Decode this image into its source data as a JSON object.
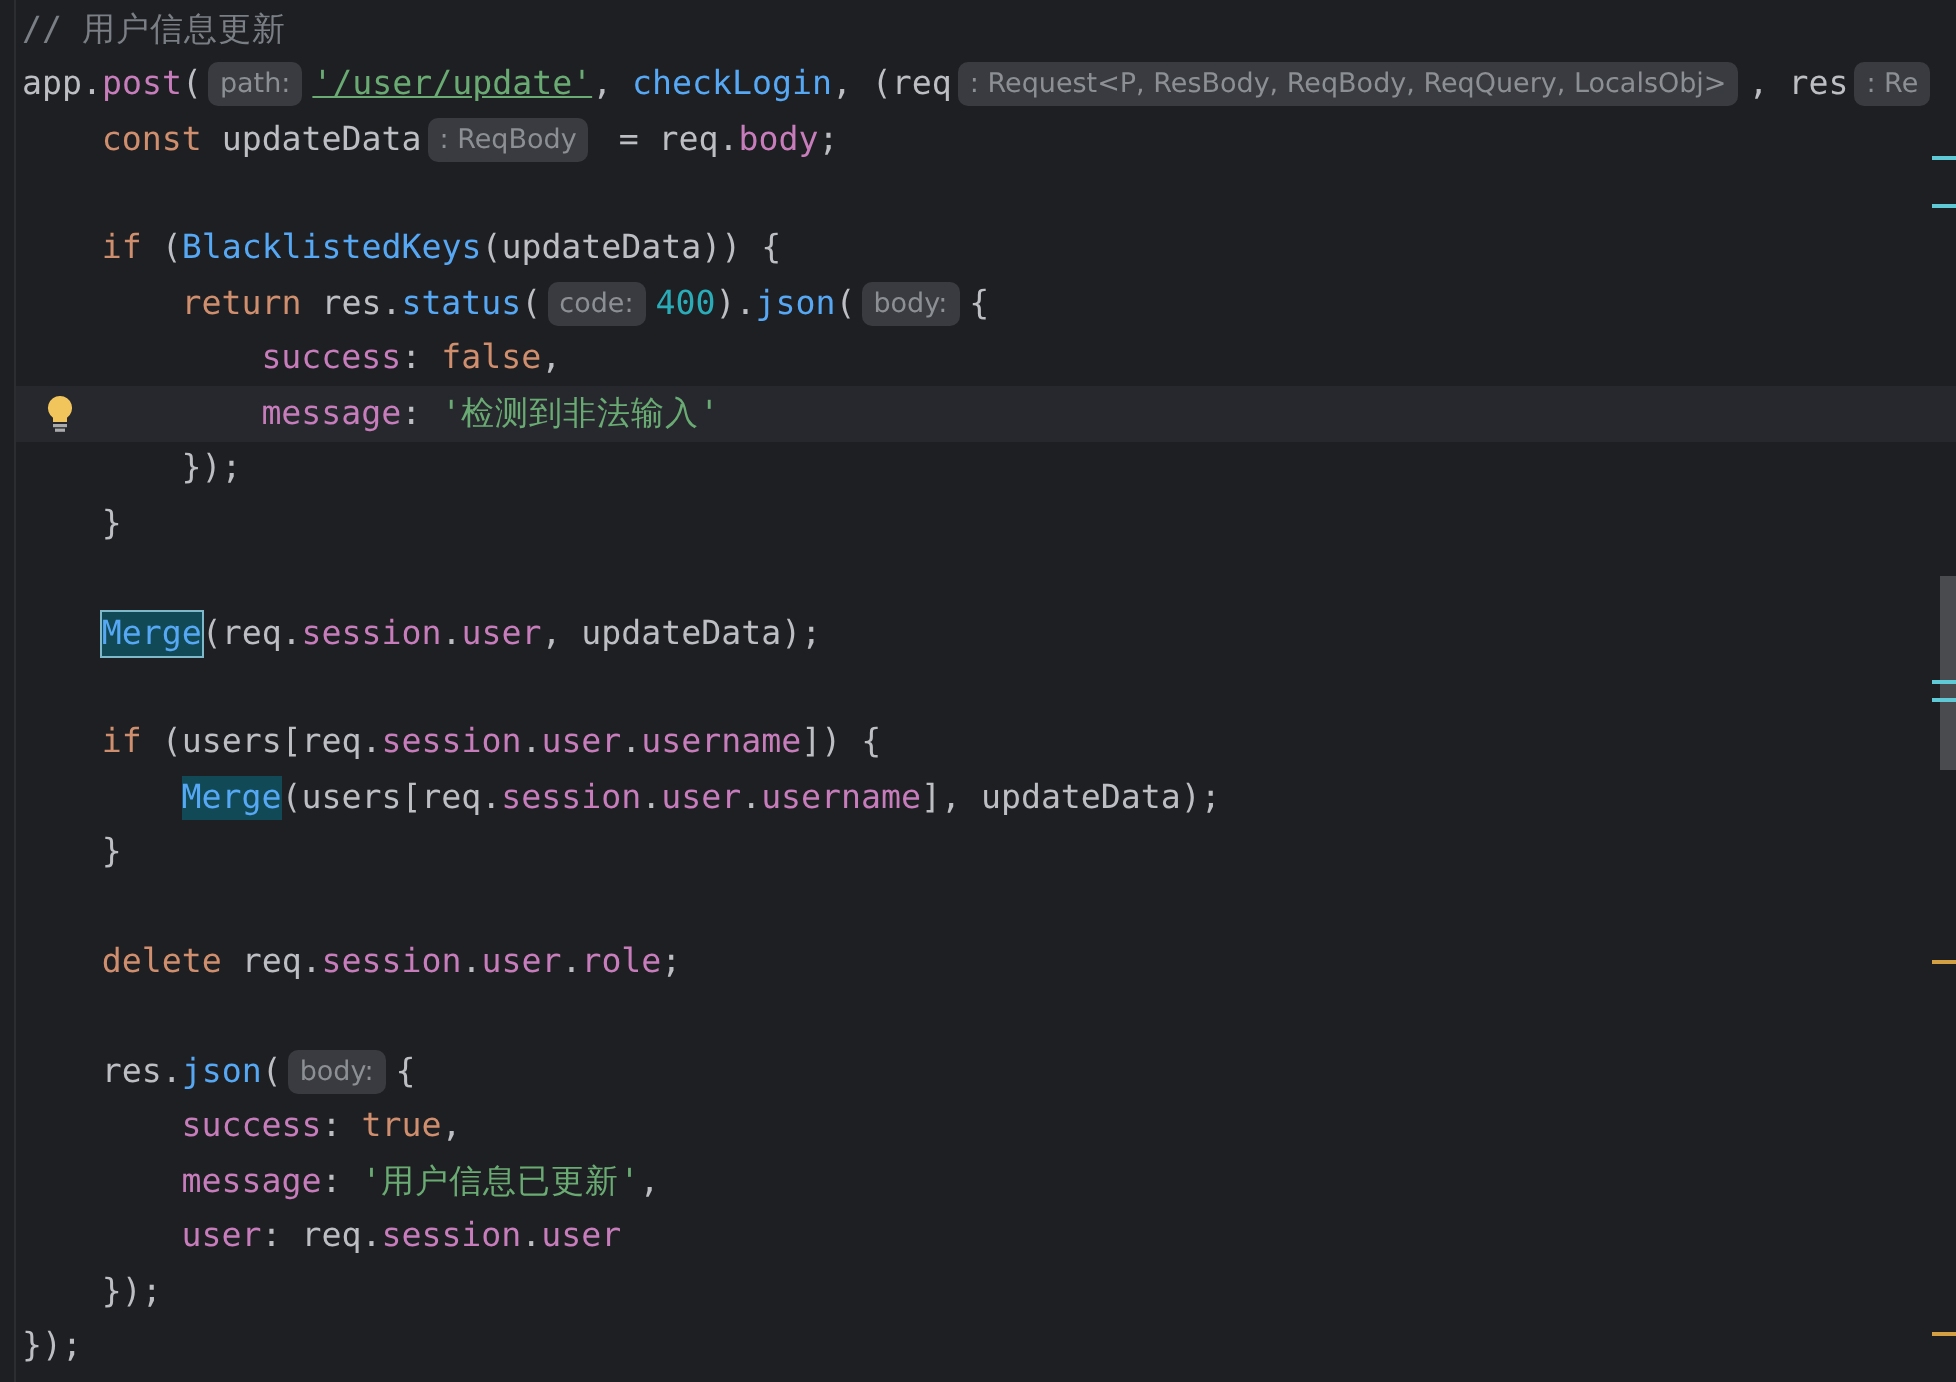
{
  "editor": {
    "lines": [
      {
        "current": false,
        "tokens": [
          {
            "kind": "comment",
            "t": "// 用户信息更新"
          }
        ]
      },
      {
        "current": false,
        "tokens": [
          {
            "kind": "plain",
            "t": "app."
          },
          {
            "kind": "prop",
            "t": "post"
          },
          {
            "kind": "plain",
            "t": "("
          },
          {
            "kind": "hint",
            "t": "path:"
          },
          {
            "kind": "link",
            "t": "'/user/update'"
          },
          {
            "kind": "plain",
            "t": ", "
          },
          {
            "kind": "fn",
            "t": "checkLogin"
          },
          {
            "kind": "plain",
            "t": ", (req"
          },
          {
            "kind": "hint",
            "t": ": Request<P, ResBody, ReqBody, ReqQuery, LocalsObj>"
          },
          {
            "kind": "plain",
            "t": ", res"
          },
          {
            "kind": "hint",
            "t": ": Re"
          }
        ],
        "children": [
          {
            "current": false,
            "tokens": [
              {
                "kind": "kw",
                "t": "const"
              },
              {
                "kind": "plain",
                "t": " updateData"
              },
              {
                "kind": "hint",
                "t": ": ReqBody"
              },
              {
                "kind": "plain",
                "t": " = req."
              },
              {
                "kind": "prop",
                "t": "body"
              },
              {
                "kind": "plain",
                "t": ";"
              }
            ]
          },
          {
            "current": false
          },
          {
            "current": false,
            "tokens": [
              {
                "kind": "kw",
                "t": "if"
              },
              {
                "kind": "plain",
                "t": " ("
              },
              {
                "kind": "fn",
                "t": "BlacklistedKeys"
              },
              {
                "kind": "plain",
                "t": "(updateData)) {"
              }
            ],
            "children": [
              {
                "current": false,
                "tokens": [
                  {
                    "kind": "kw",
                    "t": "return"
                  },
                  {
                    "kind": "plain",
                    "t": " res."
                  },
                  {
                    "kind": "fn",
                    "t": "status"
                  },
                  {
                    "kind": "plain",
                    "t": "("
                  },
                  {
                    "kind": "hint",
                    "t": "code:"
                  },
                  {
                    "kind": "num",
                    "t": "400"
                  },
                  {
                    "kind": "plain",
                    "t": ")."
                  },
                  {
                    "kind": "fn",
                    "t": "json"
                  },
                  {
                    "kind": "plain",
                    "t": "("
                  },
                  {
                    "kind": "hint",
                    "t": "body:"
                  },
                  {
                    "kind": "plain",
                    "t": "{"
                  }
                ],
                "children": [
                  {
                    "current": false,
                    "tokens": [
                      {
                        "kind": "prop",
                        "t": "success"
                      },
                      {
                        "kind": "plain",
                        "t": ": "
                      },
                      {
                        "kind": "kw",
                        "t": "false"
                      },
                      {
                        "kind": "plain",
                        "t": ","
                      }
                    ]
                  },
                  {
                    "current": true,
                    "tokens": [
                      {
                        "kind": "prop",
                        "t": "message"
                      },
                      {
                        "kind": "plain",
                        "t": ": "
                      },
                      {
                        "kind": "str",
                        "t": "'检测到非法输入'"
                      }
                    ]
                  }
                ]
              },
              {
                "current": false,
                "tokens": [
                  {
                    "kind": "plain",
                    "t": "});"
                  }
                ]
              }
            ]
          },
          {
            "current": false,
            "tokens": [
              {
                "kind": "plain",
                "t": "}"
              }
            ]
          },
          {
            "current": false
          },
          {
            "current": false,
            "tokens": [
              {
                "kind": "focus",
                "t": "Merge"
              },
              {
                "kind": "plain",
                "t": "(req."
              },
              {
                "kind": "prop",
                "t": "session"
              },
              {
                "kind": "plain",
                "t": "."
              },
              {
                "kind": "prop",
                "t": "user"
              },
              {
                "kind": "plain",
                "t": ", updateData);"
              }
            ]
          },
          {
            "current": false
          },
          {
            "current": false,
            "tokens": [
              {
                "kind": "kw",
                "t": "if"
              },
              {
                "kind": "plain",
                "t": " (users[req."
              },
              {
                "kind": "prop",
                "t": "session"
              },
              {
                "kind": "plain",
                "t": "."
              },
              {
                "kind": "prop",
                "t": "user"
              },
              {
                "kind": "plain",
                "t": "."
              },
              {
                "kind": "prop",
                "t": "username"
              },
              {
                "kind": "plain",
                "t": "]) {"
              }
            ],
            "children": [
              {
                "current": false,
                "tokens": [
                  {
                    "kind": "match",
                    "t": "Merge"
                  },
                  {
                    "kind": "plain",
                    "t": "(users[req."
                  },
                  {
                    "kind": "prop",
                    "t": "session"
                  },
                  {
                    "kind": "plain",
                    "t": "."
                  },
                  {
                    "kind": "prop",
                    "t": "user"
                  },
                  {
                    "kind": "plain",
                    "t": "."
                  },
                  {
                    "kind": "prop",
                    "t": "username"
                  },
                  {
                    "kind": "plain",
                    "t": "], updateData);"
                  }
                ]
              }
            ]
          },
          {
            "current": false,
            "tokens": [
              {
                "kind": "plain",
                "t": "}"
              }
            ]
          },
          {
            "current": false
          },
          {
            "current": false,
            "tokens": [
              {
                "kind": "kw",
                "t": "delete"
              },
              {
                "kind": "plain",
                "t": " req."
              },
              {
                "kind": "prop",
                "t": "session"
              },
              {
                "kind": "plain",
                "t": "."
              },
              {
                "kind": "prop",
                "t": "user"
              },
              {
                "kind": "plain",
                "t": "."
              },
              {
                "kind": "prop",
                "t": "role"
              },
              {
                "kind": "plain",
                "t": ";"
              }
            ]
          },
          {
            "current": false
          },
          {
            "current": false,
            "tokens": [
              {
                "kind": "plain",
                "t": "res."
              },
              {
                "kind": "fn",
                "t": "json"
              },
              {
                "kind": "plain",
                "t": "("
              },
              {
                "kind": "hint",
                "t": "body:"
              },
              {
                "kind": "plain",
                "t": "{"
              }
            ],
            "children": [
              {
                "current": false,
                "tokens": [
                  {
                    "kind": "prop",
                    "t": "success"
                  },
                  {
                    "kind": "plain",
                    "t": ": "
                  },
                  {
                    "kind": "kw",
                    "t": "true"
                  },
                  {
                    "kind": "plain",
                    "t": ","
                  }
                ]
              },
              {
                "current": false,
                "tokens": [
                  {
                    "kind": "prop",
                    "t": "message"
                  },
                  {
                    "kind": "plain",
                    "t": ": "
                  },
                  {
                    "kind": "str",
                    "t": "'用户信息已更新'"
                  },
                  {
                    "kind": "plain",
                    "t": ","
                  }
                ]
              },
              {
                "current": false,
                "tokens": [
                  {
                    "kind": "prop",
                    "t": "user"
                  },
                  {
                    "kind": "plain",
                    "t": ": req."
                  },
                  {
                    "kind": "prop",
                    "t": "session"
                  },
                  {
                    "kind": "plain",
                    "t": "."
                  },
                  {
                    "kind": "prop",
                    "t": "user"
                  }
                ]
              }
            ]
          },
          {
            "current": false,
            "tokens": [
              {
                "kind": "plain",
                "t": "});"
              }
            ]
          }
        ]
      },
      {
        "current": false,
        "tokens": [
          {
            "kind": "plain",
            "t": "});"
          }
        ]
      }
    ]
  }
}
